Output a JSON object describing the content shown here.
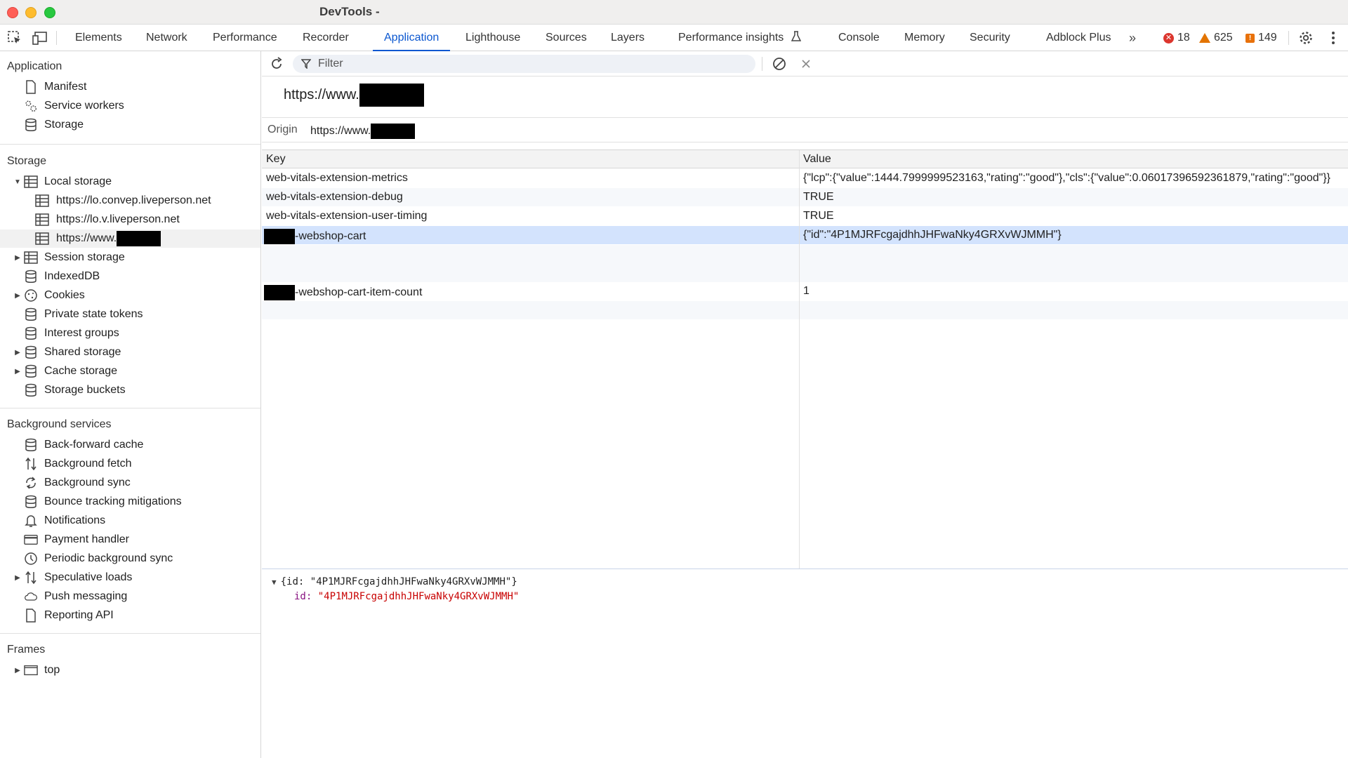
{
  "window": {
    "title": "DevTools -"
  },
  "tabs": [
    {
      "label": "Elements"
    },
    {
      "label": "Network"
    },
    {
      "label": "Performance"
    },
    {
      "label": "Recorder"
    },
    {
      "label": "Application"
    },
    {
      "label": "Lighthouse"
    },
    {
      "label": "Sources"
    },
    {
      "label": "Layers"
    },
    {
      "label": "Performance insights"
    },
    {
      "label": "Console"
    },
    {
      "label": "Memory"
    },
    {
      "label": "Security"
    },
    {
      "label": "Adblock Plus"
    }
  ],
  "active_tab": "Application",
  "counts": {
    "errors": "18",
    "warnings": "625",
    "issues": "149"
  },
  "colors": {
    "accent": "#0b57d0",
    "selected_row": "#d3e3fd",
    "error": "#dc362e",
    "warning": "#e37400"
  },
  "sidebar": {
    "application": {
      "title": "Application",
      "items": [
        {
          "label": "Manifest",
          "icon": "document-icon"
        },
        {
          "label": "Service workers",
          "icon": "gears-icon"
        },
        {
          "label": "Storage",
          "icon": "database-icon"
        }
      ]
    },
    "storage": {
      "title": "Storage",
      "local_storage": "Local storage",
      "local_children": [
        {
          "label": "https://lo.convep.liveperson.net"
        },
        {
          "label": "https://lo.v.liveperson.net"
        },
        {
          "label": "https://www."
        }
      ],
      "items": [
        {
          "label": "Session storage"
        },
        {
          "label": "IndexedDB"
        },
        {
          "label": "Cookies"
        },
        {
          "label": "Private state tokens"
        },
        {
          "label": "Interest groups"
        },
        {
          "label": "Shared storage"
        },
        {
          "label": "Cache storage"
        },
        {
          "label": "Storage buckets"
        }
      ]
    },
    "background": {
      "title": "Background services",
      "items": [
        {
          "label": "Back-forward cache"
        },
        {
          "label": "Background fetch"
        },
        {
          "label": "Background sync"
        },
        {
          "label": "Bounce tracking mitigations"
        },
        {
          "label": "Notifications"
        },
        {
          "label": "Payment handler"
        },
        {
          "label": "Periodic background sync"
        },
        {
          "label": "Speculative loads"
        },
        {
          "label": "Push messaging"
        },
        {
          "label": "Reporting API"
        }
      ]
    },
    "frames": {
      "title": "Frames",
      "items": [
        {
          "label": "top"
        }
      ]
    }
  },
  "main": {
    "filter_placeholder": "Filter",
    "origin_heading": "https://www.",
    "origin_label": "Origin",
    "origin_value": "https://www.",
    "columns": {
      "key": "Key",
      "value": "Value"
    },
    "rows": [
      {
        "key": "web-vitals-extension-metrics",
        "value": "{\"lcp\":{\"value\":1444.7999999523163,\"rating\":\"good\"},\"cls\":{\"value\":0.06017396592361879,\"rating\":\"good\"}}"
      },
      {
        "key": "web-vitals-extension-debug",
        "value": "TRUE"
      },
      {
        "key": "web-vitals-extension-user-timing",
        "value": "TRUE"
      },
      {
        "key": "-webshop-cart",
        "value": "{\"id\":\"4P1MJRFcgajdhhJHFwaNky4GRXvWJMMH\"}"
      },
      {
        "key": "-webshop-cart-item-count",
        "value": "1"
      }
    ],
    "preview": {
      "summary": "{id: \"4P1MJRFcgajdhhJHFwaNky4GRXvWJMMH\"}",
      "prop_key": "id:",
      "prop_value": "\"4P1MJRFcgajdhhJHFwaNky4GRXvWJMMH\""
    }
  }
}
